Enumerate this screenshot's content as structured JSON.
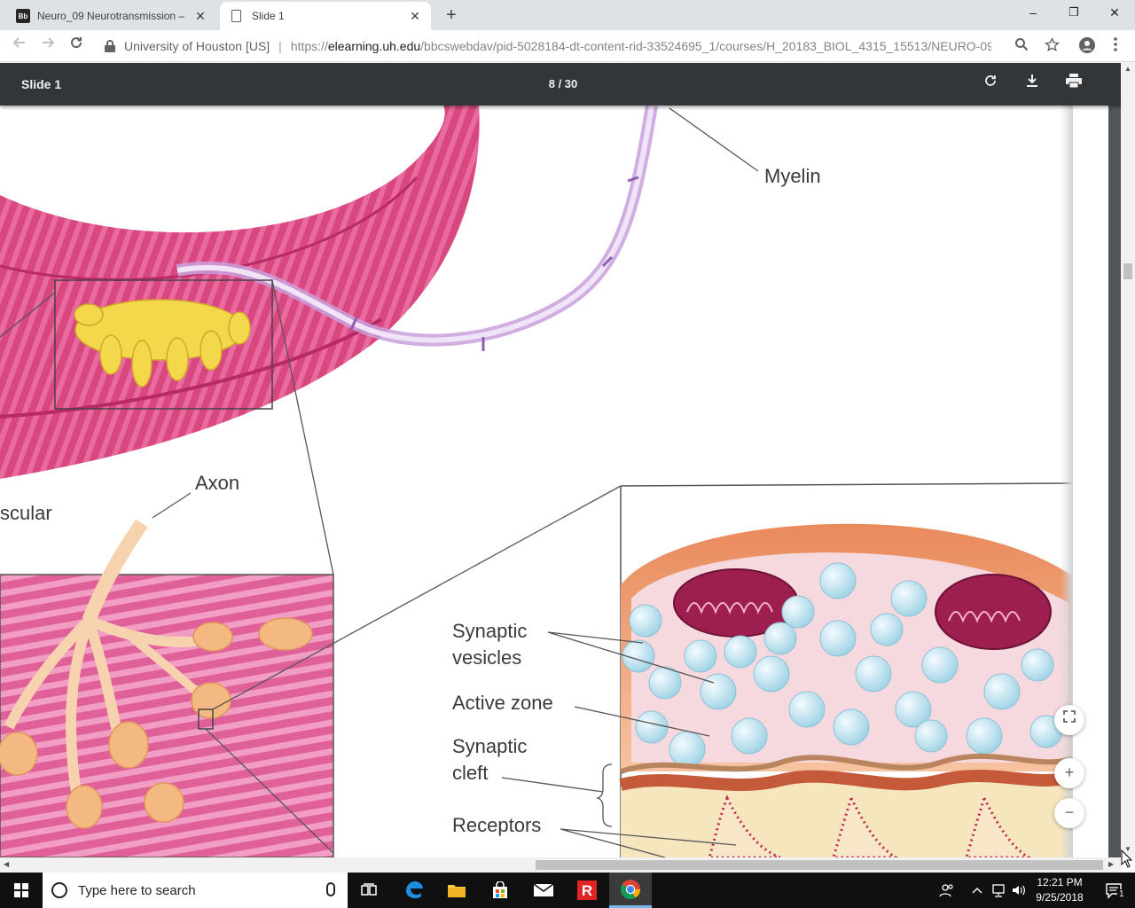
{
  "browser": {
    "tabs": [
      {
        "title": "Neuro_09 Neurotransmission – ",
        "favicon": "Bb",
        "active": false
      },
      {
        "title": "Slide 1",
        "favicon": "document-icon",
        "active": true
      }
    ],
    "window_controls": {
      "minimize": "–",
      "restore": "❐",
      "close": "✕"
    },
    "omnibox": {
      "site_identity": "University of Houston [US]",
      "separator": "|",
      "url_scheme": "https://",
      "url_host": "elearning.uh.edu",
      "url_path": "/bbcswebdav/pid-5028184-dt-content-rid-33524695_1/courses/H_20183_BIOL_4315_15513/NEURO-09_..."
    }
  },
  "pdf_viewer": {
    "title": "Slide 1",
    "page_indicator": "8  /  30",
    "current_page": 8,
    "total_pages": 30
  },
  "figure_labels": {
    "myelin": "Myelin",
    "axon": "Axon",
    "muscular_fragment": "scular",
    "synaptic_vesicles_line1": "Synaptic",
    "synaptic_vesicles_line2": "vesicles",
    "active_zone": "Active zone",
    "synaptic_cleft_line1": "Synaptic",
    "synaptic_cleft_line2": "cleft",
    "receptors": "Receptors"
  },
  "taskbar": {
    "search_placeholder": "Type here to search",
    "time": "12:21 PM",
    "date": "9/25/2018",
    "notification_count": "1",
    "apps": [
      "task-view",
      "edge",
      "file-explorer",
      "store",
      "mail",
      "r-app",
      "chrome"
    ]
  },
  "colors": {
    "tabstrip": "#dee1e6",
    "pdf_toolbar": "#323639",
    "muscle_pink": "#d9477f",
    "nerve_purple": "#c8a0dc",
    "terminal_yellow": "#f3d84c",
    "vesicle_blue": "#bfe3ee",
    "mitochondria": "#9c1f4f",
    "taskbar": "#101010"
  }
}
